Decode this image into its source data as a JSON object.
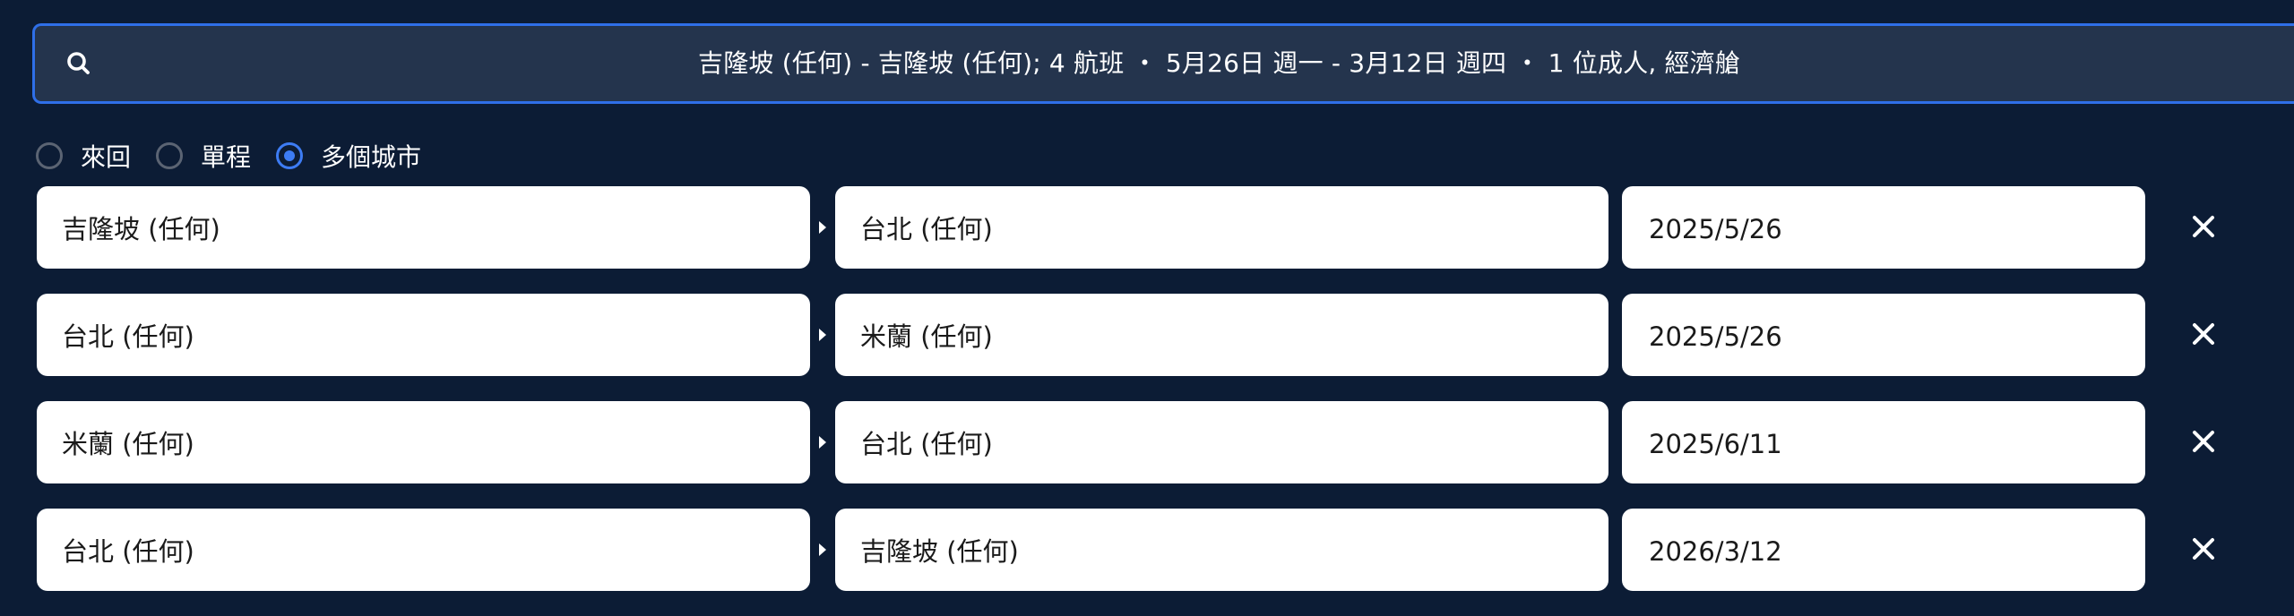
{
  "summary": {
    "text": "吉隆坡 (任何) - 吉隆坡 (任何); 4 航班 ・ 5月26日 週一 - 3月12日 週四 ・ 1 位成人, 經濟艙",
    "search_icon": "search-icon"
  },
  "trip_types": [
    {
      "label": "來回",
      "selected": false
    },
    {
      "label": "單程",
      "selected": false
    },
    {
      "label": "多個城市",
      "selected": true
    }
  ],
  "legs": [
    {
      "origin": "吉隆坡 (任何)",
      "destination": "台北 (任何)",
      "date": "2025/5/26"
    },
    {
      "origin": "台北 (任何)",
      "destination": "米蘭 (任何)",
      "date": "2025/5/26"
    },
    {
      "origin": "米蘭 (任何)",
      "destination": "台北 (任何)",
      "date": "2025/6/11"
    },
    {
      "origin": "台北 (任何)",
      "destination": "吉隆坡 (任何)",
      "date": "2026/3/12"
    }
  ],
  "icons": {
    "leg_arrow": "caret-right-icon",
    "remove": "close-icon"
  },
  "colors": {
    "background": "#0c1c35",
    "summary_bar": "#24344d",
    "accent": "#2f6fe8",
    "field": "#ffffff"
  }
}
